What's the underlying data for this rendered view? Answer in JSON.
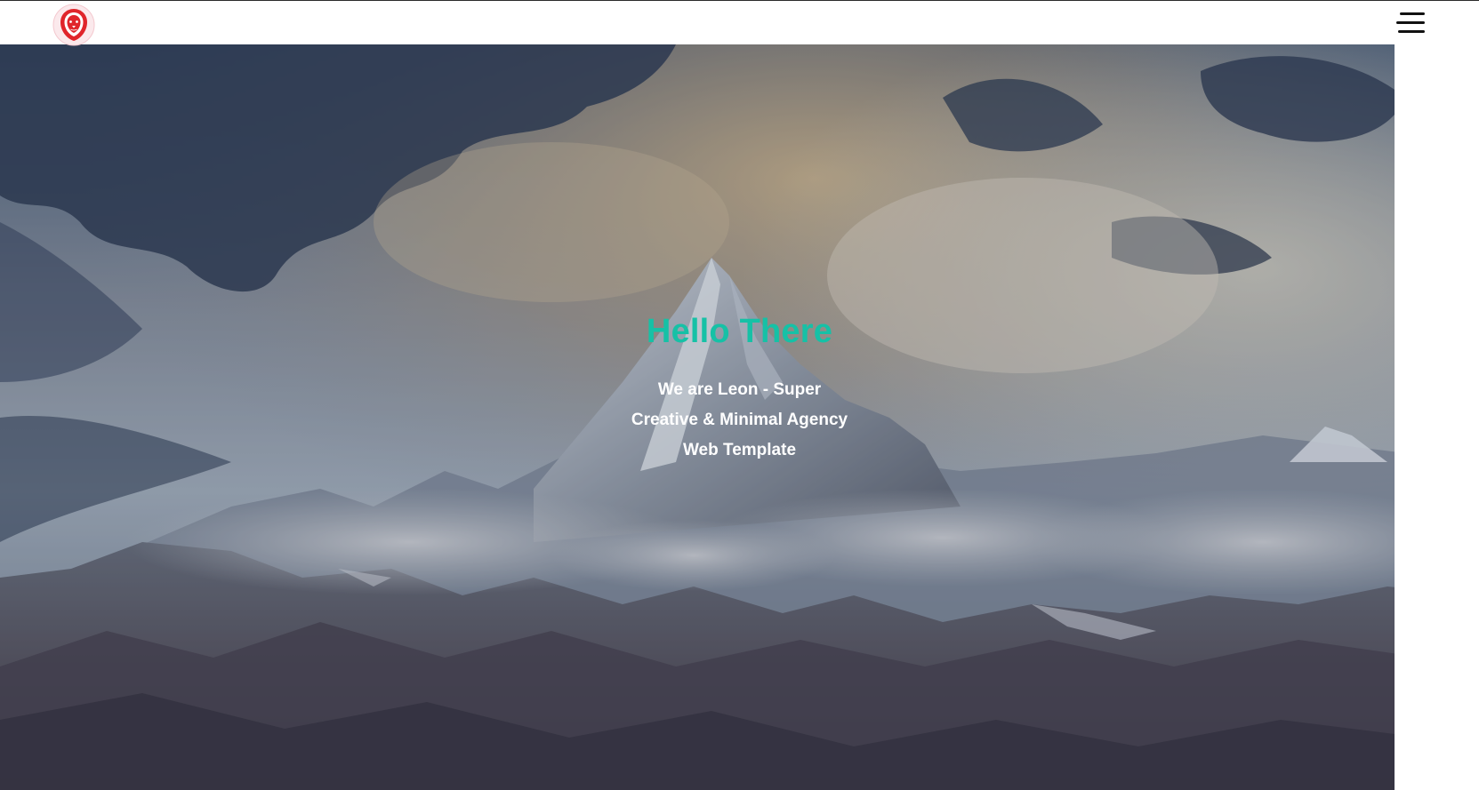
{
  "navbar": {
    "logo_icon": "lion-logo-icon",
    "menu_icon": "hamburger-menu-icon"
  },
  "hero": {
    "title": "Hello There",
    "subtitle_lines": [
      "We are Leon - Super",
      "Creative & Minimal Agency",
      "Web Template"
    ],
    "background": "mountain-peak-with-clouds-photo"
  },
  "colors": {
    "accent": "#16c1a6",
    "text_light": "#ffffff",
    "logo_red": "#e0252b"
  }
}
